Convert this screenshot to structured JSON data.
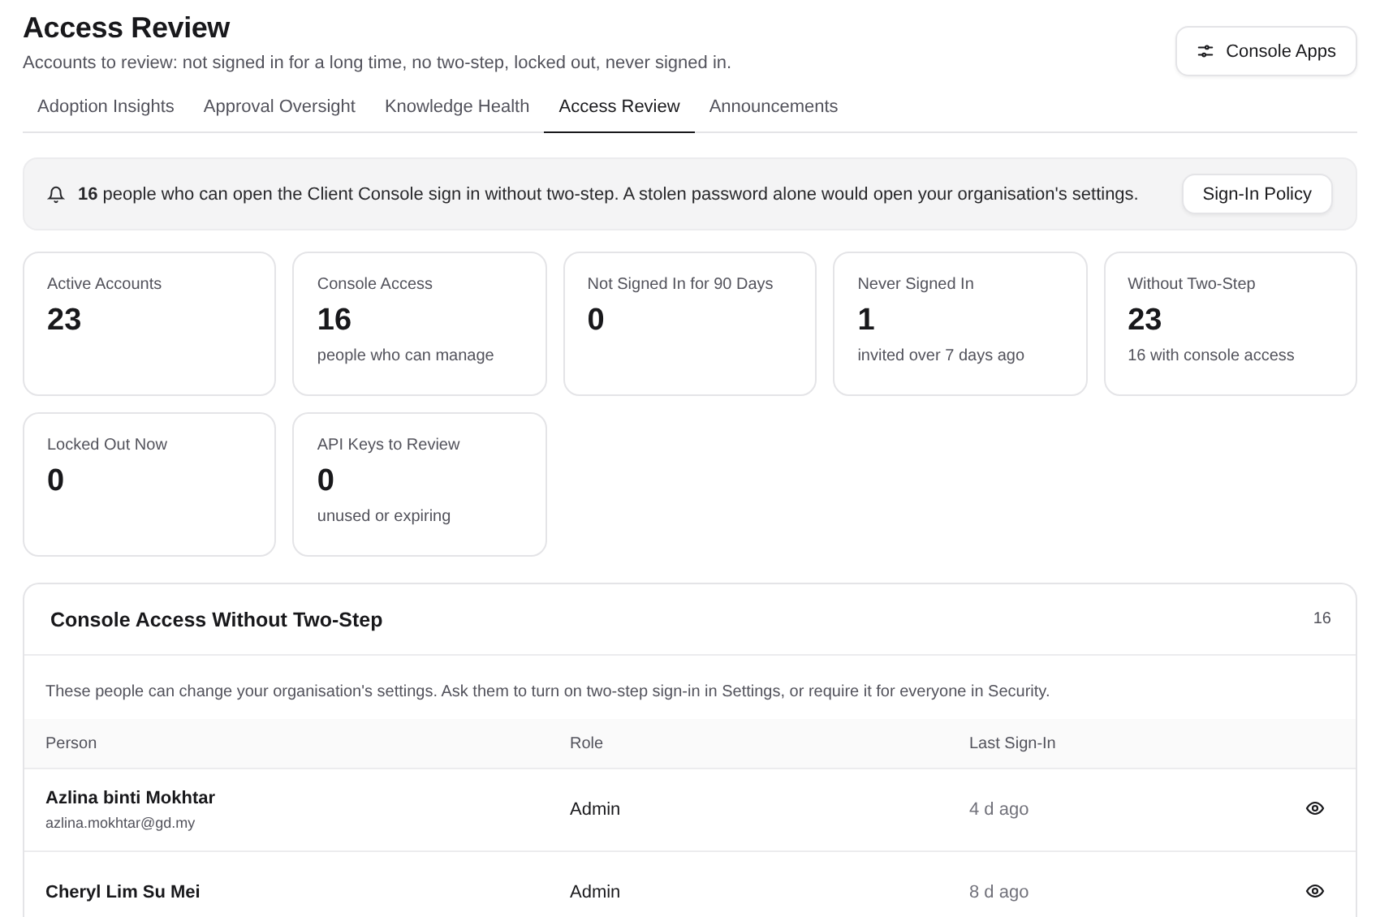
{
  "header": {
    "title": "Access Review",
    "subtitle": "Accounts to review: not signed in for a long time, no two-step, locked out, never signed in.",
    "action": "Console Apps"
  },
  "tabs": [
    {
      "label": "Adoption Insights",
      "selected": false
    },
    {
      "label": "Approval Oversight",
      "selected": false
    },
    {
      "label": "Knowledge Health",
      "selected": false
    },
    {
      "label": "Access Review",
      "selected": true
    },
    {
      "label": "Announcements",
      "selected": false
    }
  ],
  "alert": {
    "message": "**16** people who can open the Client Console sign in without two-step. A stolen password alone would open your organisation's settings.",
    "action": "Sign-In Policy"
  },
  "stats": [
    {
      "label": "Active Accounts",
      "value": "23"
    },
    {
      "label": "Console Access",
      "value": "16",
      "note": "people who can manage"
    },
    {
      "label": "Not Signed In for 90 Days",
      "value": "0"
    },
    {
      "label": "Never Signed In",
      "value": "1",
      "note": "invited over 7 days ago"
    },
    {
      "label": "Without Two-Step",
      "value": "23",
      "note": "16 with console access"
    },
    {
      "label": "Locked Out Now",
      "value": "0"
    },
    {
      "label": "API Keys to Review",
      "value": "0",
      "note": "unused or expiring"
    }
  ],
  "table": {
    "title": "Console Access Without Two-Step",
    "count": "16",
    "description": "These people can change your organisation's settings. Ask them to turn on two-step sign-in in Settings, or require it for everyone in Security.",
    "columns": [
      "Person",
      "Role",
      "Last Sign-In"
    ],
    "rows": [
      {
        "name": "Azlina binti Mokhtar",
        "email": "azlina.mokhtar@gd.my",
        "role": "Admin",
        "last_sign_in": "4 d ago"
      },
      {
        "name": "Cheryl Lim Su Mei",
        "role": "Admin",
        "last_sign_in": "8 d ago"
      }
    ]
  }
}
